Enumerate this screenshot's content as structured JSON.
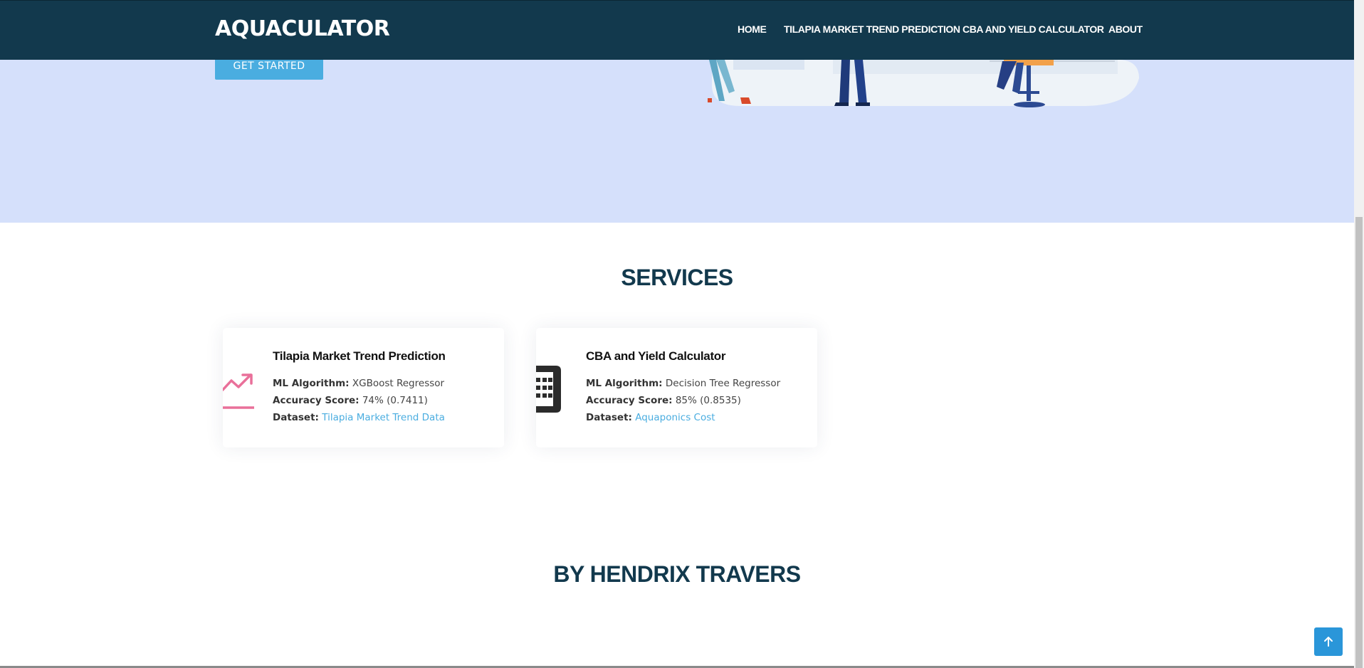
{
  "navbar": {
    "brand": "AQUACULATOR",
    "links": [
      {
        "label": "HOME"
      },
      {
        "label": "TILAPIA MARKET TREND PREDICTION"
      },
      {
        "label": "CBA AND YIELD CALCULATOR"
      },
      {
        "label": "ABOUT"
      }
    ]
  },
  "hero": {
    "cta_label": "GET STARTED"
  },
  "services": {
    "title": "SERVICES",
    "cards": [
      {
        "icon": "trend-up-icon",
        "title": "Tilapia Market Trend Prediction",
        "algorithm_label": "ML Algorithm:",
        "algorithm_value": "XGBoost Regressor",
        "accuracy_label": "Accuracy Score:",
        "accuracy_value": "74% (0.7411)",
        "dataset_label": "Dataset:",
        "dataset_link": "Tilapia Market Trend Data"
      },
      {
        "icon": "calculator-icon",
        "title": "CBA and Yield Calculator",
        "algorithm_label": "ML Algorithm:",
        "algorithm_value": "Decision Tree Regressor",
        "accuracy_label": "Accuracy Score:",
        "accuracy_value": "85% (0.8535)",
        "dataset_label": "Dataset:",
        "dataset_link": "Aquaponics Cost"
      }
    ]
  },
  "author": {
    "title": "BY HENDRIX TRAVERS"
  },
  "colors": {
    "navbar_bg": "#12394d",
    "hero_bg": "#d5e0fb",
    "accent": "#4aade0",
    "trend_icon": "#e9709a",
    "back_to_top": "#2a96d9"
  }
}
